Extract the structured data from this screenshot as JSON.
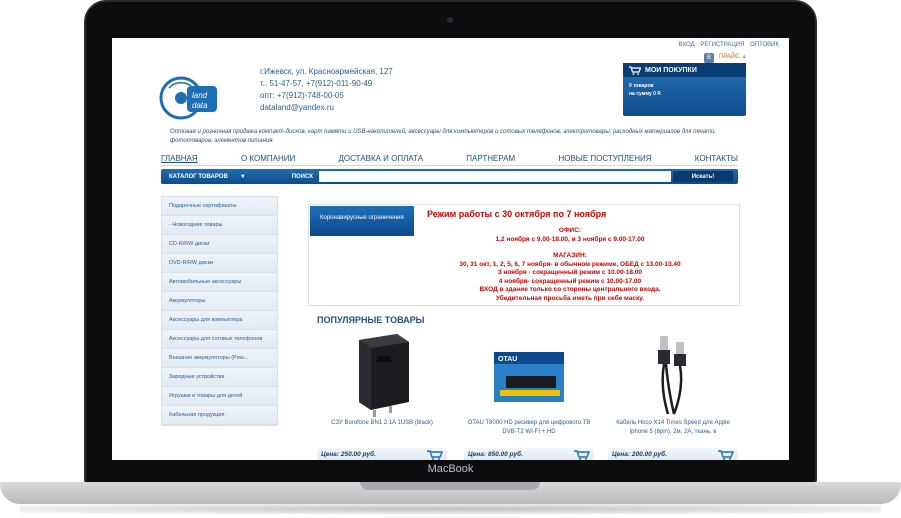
{
  "device": {
    "brand": "MacBook"
  },
  "header": {
    "links": [
      "ВХОД",
      "РЕГИСТРАЦИЯ",
      "ОПТОВИК"
    ],
    "vk_label": "В",
    "price_link": "ПРАЙС",
    "logo_icon": "dataland-disc-logo",
    "contacts": {
      "address": "г.Ижевск, ул. Красноармейская, 127",
      "phone": "т.: 51-47-57, +7(912)-011-90-49",
      "wholesale": "опт: +7(912)-748-00-05",
      "email": "dataland@yandex.ru"
    },
    "cart": {
      "title": "МОИ ПОКУПКИ",
      "items": "0 товаров",
      "sum": "на сумму 0 Р."
    }
  },
  "tagline": "Оптовая и розничная продажа компакт-дисков, карт памяти и USB-накопителей, аксессуары для компьютеров и сотовых телефонов, электротовары, расходных материалов для печати, фототоваров, элементов питания.",
  "nav": [
    "ГЛАВНАЯ",
    "О КОМПАНИИ",
    "ДОСТАВКА И ОПЛАТА",
    "ПАРТНЕРАМ",
    "НОВЫЕ ПОСТУПЛЕНИЯ",
    "КОНТАКТЫ"
  ],
  "search": {
    "catalog_label": "КАТАЛОГ ТОВАРОВ",
    "label": "ПОИСК",
    "placeholder": "",
    "button": "Искать!"
  },
  "sidebar": [
    "Подарочные сертификаты",
    "- Новогодние товары",
    "CD-R/RW диски",
    "DVD-R/RW диски",
    "Автомобильные аксессуары",
    "Аккумуляторы",
    "Аксессуары для компьютера",
    "Аксессуары для сотовых телефонов",
    "Внешние аккумуляторы (Pow...",
    "Зарядные устройства",
    "Игрушки и товары для детей",
    "Кабельная продукция"
  ],
  "notice": {
    "badge": "Коронавирусные ограничения",
    "title": "Режим работы с 30 октября по 7 ноября",
    "office_title": "ОФИС:",
    "office_text": "1,2 ноября с 9.00-18.00, и 3 ноября с 9.00-17.00",
    "shop_title": "МАГАЗИН:",
    "shop_lines": [
      "30, 31 окт, 1, 2, 5, 6, 7 ноября- в обычном режиме, ОБЕД с 13.00-13.40",
      "3 ноября - сокращенный режим с 10.00-18.00",
      "4 ноября- сокращенный режим с 10.00-17.00",
      "ВХОД в здание только со стороны центрального входа.",
      "Убедительная просьба иметь при себе маску."
    ]
  },
  "popular": {
    "title": "ПОПУЛЯРНЫЕ ТОВАРЫ",
    "products": [
      {
        "name": "СЗУ Borofone BN1 2.1A 1USB (black)",
        "price": "Цена: 250.00 руб."
      },
      {
        "name": "OTAU T8000 HD ресивер для цифрового ТВ DVB-T2 WI-FI + HD",
        "price": "Цена: 850.00 руб."
      },
      {
        "name": "Кабель Hoco X14 Times Speed для Apple Iphone 5 (8pin), 2м, 2A, ткань, в",
        "price": "Цена: 200.00 руб."
      }
    ]
  },
  "colors": {
    "accent": "#1f6db3",
    "alert": "#d40000",
    "link": "#2a5f96"
  }
}
